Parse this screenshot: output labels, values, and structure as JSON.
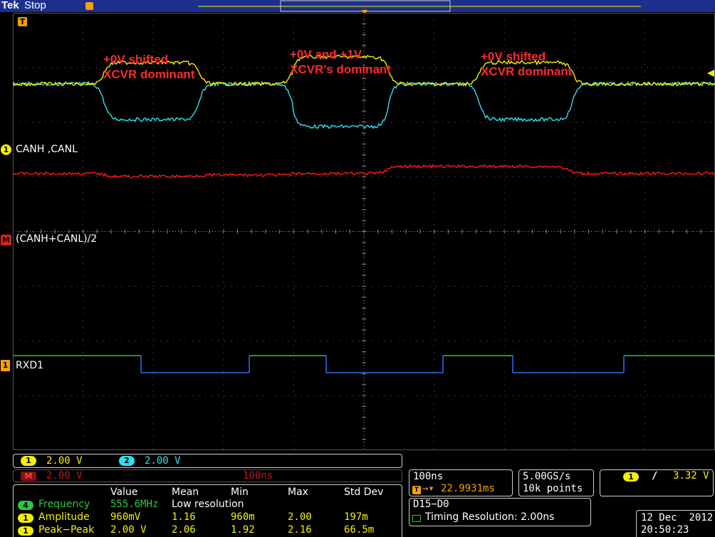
{
  "header": {
    "brand": "Tek",
    "status": "Stop"
  },
  "annotations": [
    {
      "line1": "+0V shifted",
      "line2": "XCVR dominant"
    },
    {
      "line1": "+0V and +1V",
      "line2": "XCVR's dominant"
    },
    {
      "line1": "+0V shifted",
      "line2": "XCVR dominant"
    }
  ],
  "traces": {
    "ch1_label": "CANH ,CANL",
    "math_label": "(CANH+CANL)/2",
    "digital_label": "RXD1",
    "ch1_badge": "1",
    "math_badge": "M",
    "digital_badge": "1",
    "trigger_badge": "T"
  },
  "colors": {
    "ch1": "#f5f000",
    "ch2": "#2fe0f0",
    "math": "#ff1a1a",
    "digital_high": "#2ec840",
    "digital_low": "#2f6ff0",
    "grid": "#6a6a6a"
  },
  "channels": {
    "ch1": {
      "badge": "1",
      "scale": "2.00 V"
    },
    "ch2": {
      "badge": "2",
      "scale": "2.00 V"
    },
    "math": {
      "badge": "M",
      "scale": "2.00 V",
      "time": "100ns"
    }
  },
  "measurements": {
    "headers": [
      "Value",
      "Mean",
      "Min",
      "Max",
      "Std Dev"
    ],
    "rows": [
      {
        "badge": "4",
        "name": "Frequency",
        "value": "555.6MHz",
        "note": "Low resolution",
        "mean": "",
        "min": "",
        "max": "",
        "std": ""
      },
      {
        "badge": "1",
        "name": "Amplitude",
        "value": "960mV",
        "note": "",
        "mean": "1.16",
        "min": "960m",
        "max": "2.00",
        "std": "197m"
      },
      {
        "badge": "1",
        "name": "Peak−Peak",
        "value": "2.00 V",
        "note": "",
        "mean": "2.06",
        "min": "1.92",
        "max": "2.16",
        "std": "66.5m"
      }
    ]
  },
  "timebase": {
    "scale": "100ns",
    "trigger_pos": "22.9931ms"
  },
  "acquisition": {
    "rate": "5.00GS/s",
    "points": "10k points"
  },
  "trigger": {
    "badge": "1",
    "slope": "∕",
    "level": "3.32 V"
  },
  "digital": {
    "title": "D15−D0",
    "resolution": "Timing Resolution: 2.00ns"
  },
  "datetime": {
    "date": "12 Dec  2012",
    "time": "20:50:23"
  }
}
